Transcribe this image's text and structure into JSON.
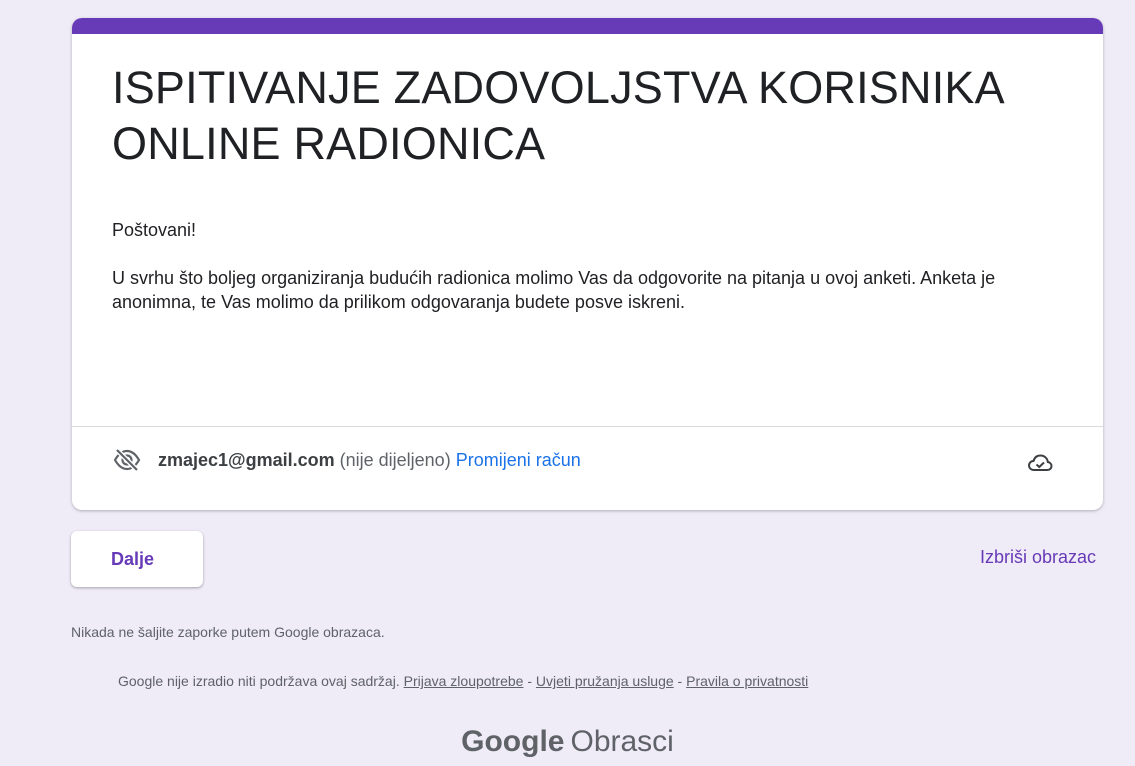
{
  "theme": {
    "accent": "#673ab7",
    "background": "#efebf7",
    "link": "#1a73e8"
  },
  "form": {
    "title": "ISPITIVANJE ZADOVOLJSTVA KORISNIKA ONLINE RADIONICA",
    "greeting": "Poštovani!",
    "description": "U svrhu što boljeg organiziranja budućih radionica molimo Vas da odgovorite na pitanja u ovoj anketi. Anketa je anonimna, te Vas molimo da prilikom odgovaranja budete posve iskreni."
  },
  "account": {
    "icon": "eye-off-icon",
    "email": "zmajec1@gmail.com",
    "status": "(nije dijeljeno)",
    "change_label": "Promijeni račun",
    "save_icon": "cloud-done-icon"
  },
  "actions": {
    "next_label": "Dalje",
    "clear_label": "Izbriši obrazac"
  },
  "footer": {
    "password_warning": "Nikada ne šaljite zaporke putem Google obrazaca.",
    "disclaimer": "Google nije izradio niti podržava ovaj sadržaj.",
    "report_abuse": "Prijava zloupotrebe",
    "separator": " - ",
    "terms": "Uvjeti pružanja usluge",
    "privacy": "Pravila o privatnosti",
    "brand_google": "Google",
    "brand_product": "Obrasci"
  }
}
